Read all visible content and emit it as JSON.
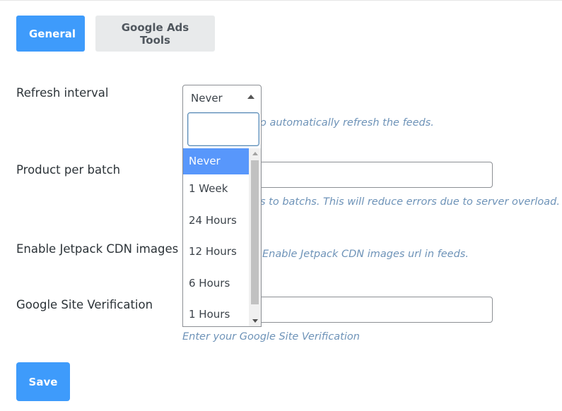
{
  "tabs": [
    {
      "label": "General",
      "active": true
    },
    {
      "label": "Google Ads Tools",
      "active": false
    }
  ],
  "settings": {
    "refresh_interval": {
      "label": "Refresh interval",
      "selected": "Never",
      "help_visible": "o automatically refresh the feeds."
    },
    "product_per_batch": {
      "label": "Product per batch",
      "value": "",
      "help_visible": "s to batchs. This will reduce errors due to server overload."
    },
    "jetpack_cdn": {
      "label": "Enable Jetpack CDN images",
      "help_visible": "Enable Jetpack CDN images url in feeds."
    },
    "site_verification": {
      "label": "Google Site Verification",
      "value": "",
      "help": "Enter your Google Site Verification"
    }
  },
  "dropdown": {
    "search_value": "",
    "options": [
      "Never",
      "1 Week",
      "24 Hours",
      "12 Hours",
      "6 Hours",
      "1 Hours"
    ],
    "selected_index": 0
  },
  "actions": {
    "save_label": "Save"
  },
  "colors": {
    "primary": "#3e9bfb",
    "help_text": "#6e93b8",
    "option_highlight": "#5897fb"
  }
}
